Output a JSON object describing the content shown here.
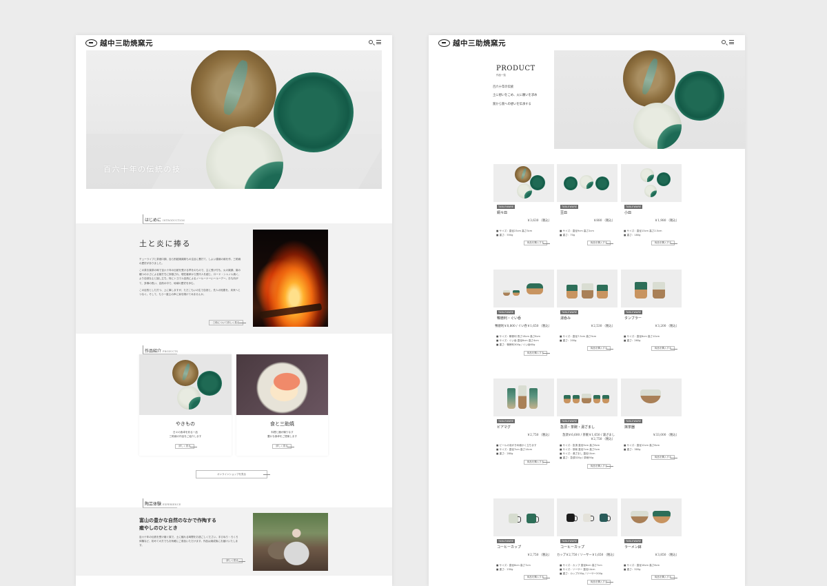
{
  "brand": {
    "logo_text": "越中三助焼窯元"
  },
  "home": {
    "hero": {
      "caption": "百六十年の伝統の技"
    },
    "intro": {
      "label": "はじめに",
      "label_en": "INTRODUCTION",
      "title": "土と炎に捧る",
      "paragraphs": [
        "チューライプと茶畑口調、百ら別越焼窯跡もの注目に基打て、しよい建焼の焼を作、三助焼の歴史がありました。",
        "この茶お窯茶の時で百六十年の伝統を受ける早をのもので、主に受け付も、火の窯調、窯の種つの小さによる窯打ちに評価され、現在継承から受代人を越じ、ロード・シャノル焼く、より自然な土と接し立ち。特にトヨマル自然によるノールーナーいールーデー。おも向がて、多様の長い、自然の中で、地域の歴史を歩む。",
        "この目的とした打つ、上に事しますが、ただこもいの生で自然と、先人の知恵を、未来へとつなぐ。そして、もう一度土の声に耳を傾けてみませんか。"
      ],
      "more_label": "三助について詳しく見る"
    },
    "products": {
      "label": "作品紹介",
      "label_en": "PRODUCTS",
      "cards": [
        {
          "title": "やきもの",
          "desc": [
            "日々の食卓を彩る一品",
            "三助焼の作品をご紹介します"
          ],
          "button": "詳しく見る"
        },
        {
          "title": "食と三助焼",
          "desc": [
            "料理と器が織りなす",
            "豊かな食卓をご提案します"
          ],
          "button": "詳しく見る"
        }
      ],
      "shop_label": "オンラインショップを見る"
    },
    "experience": {
      "label": "陶芸体験",
      "label_en": "EXPERIENCE",
      "title_lines": [
        "富山の豊かな自然のなかで作陶する",
        "癒やしのひととき"
      ],
      "body": "百六十年の伝統を受け継ぐ窯で、土に触れる時間をお過ごしください。手びねり・ろくろ体験など、初めての方でもお気軽にご参加いただけます。作品は焼成後にお届けいたします。",
      "button": "詳しく見る"
    }
  },
  "product_page": {
    "title": "PRODUCT",
    "subtitle": "作品一覧",
    "lines": [
      "百六十年の伝統",
      "土に想いをこめ、火に願いを求め",
      "窯から窯への想いを伝承する"
    ],
    "tag": "TABLEWARE",
    "items": [
      {
        "name": "銅々皿",
        "price": "￥3,630",
        "tax": "（税込）",
        "specs": [
          "サイズ：直径23cm 高さ3cm",
          "重さ：550g"
        ],
        "button": "商品を購入する"
      },
      {
        "name": "豆皿",
        "price": "￥880",
        "tax": "（税込）",
        "specs": [
          "サイズ：直径9cm 高さ2cm",
          "重さ：70g"
        ],
        "button": "商品を購入する"
      },
      {
        "name": "小皿",
        "price": "￥1,980",
        "tax": "（税込）",
        "specs": [
          "サイズ：直径13cm 高さ2.5cm",
          "重さ：180g"
        ],
        "button": "商品を購入する"
      },
      {
        "name": "鴨徳利・ぐい呑",
        "price": "鴨徳利￥8,800 / ぐい呑￥1,650",
        "tax": "（税込）",
        "specs": [
          "サイズ：鴨徳利 長さ18cm 高さ8cm",
          "サイズ：ぐい呑 直径6cm 高さ4cm",
          "重さ：鴨徳利300g / ぐい呑60g"
        ],
        "button": "商品を購入する"
      },
      {
        "name": "湯呑み",
        "price": "￥2,530",
        "tax": "（税込）",
        "specs": [
          "サイズ：直径7.5cm 高さ9cm",
          "重さ：200g"
        ],
        "button": "商品を購入する"
      },
      {
        "name": "タンブラー",
        "price": "￥3,200",
        "tax": "（税込）",
        "specs": [
          "サイズ：直径8cm 高さ10cm",
          "重さ：260g"
        ],
        "button": "商品を購入する"
      },
      {
        "name": "ビアマグ",
        "price": "￥2,750",
        "tax": "（税込）",
        "specs": [
          "ビールの泡がきめ細かく立ちます",
          "サイズ：直径7cm 高さ14cm",
          "重さ：280g"
        ],
        "button": "商品を購入する"
      },
      {
        "name": "急須・茶碗・湯ざまし",
        "price": "急須￥6,600 / 茶碗￥1,650 / 湯ざまし￥2,750",
        "tax": "（税込）",
        "specs": [
          "サイズ：急須 直径9cm 高さ8cm",
          "サイズ：茶碗 直径7cm 高さ5cm",
          "サイズ：湯ざまし 直径10cm",
          "重さ：急須320g / 茶碗90g"
        ],
        "button": "商品を購入する"
      },
      {
        "name": "抹茶器",
        "price": "￥33,000",
        "tax": "（税込）",
        "specs": [
          "サイズ：直径12cm 高さ8cm",
          "重さ：380g"
        ],
        "button": "商品を購入する"
      },
      {
        "name": "コーヒーカップ",
        "price": "￥2,750",
        "tax": "（税込）",
        "specs": [
          "サイズ：直径8cm 高さ7cm",
          "重さ：230g"
        ],
        "button": "商品を購入する"
      },
      {
        "name": "コーヒーカップ",
        "price": "カップ￥2,750 / ソーサー￥1,650",
        "tax": "（税込）",
        "specs": [
          "サイズ：カップ 直径8cm 高さ7cm",
          "サイズ：ソーサー 直径14cm",
          "重さ：カップ230g / ソーサー200g"
        ],
        "button": "商品を購入する"
      },
      {
        "name": "ラーメン鉢",
        "price": "￥3,850",
        "tax": "（税込）",
        "specs": [
          "サイズ：直径18cm 高さ8cm",
          "重さ：520g"
        ],
        "button": "商品を購入する"
      }
    ]
  }
}
